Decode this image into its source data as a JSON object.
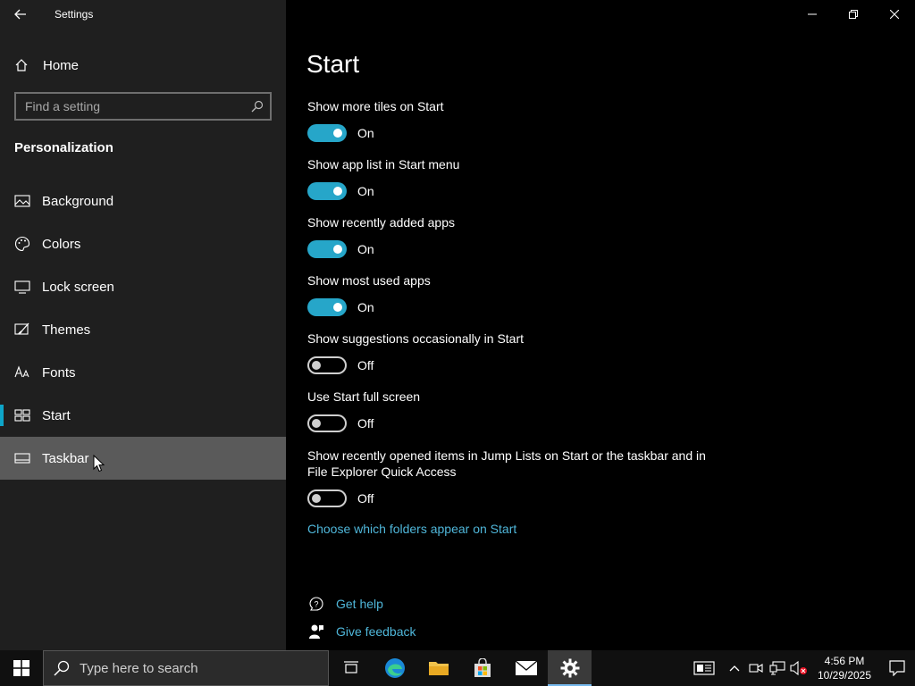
{
  "window": {
    "app_title": "Settings"
  },
  "sidebar": {
    "home_label": "Home",
    "search_placeholder": "Find a setting",
    "section_title": "Personalization",
    "items": [
      {
        "label": "Background",
        "icon": "image-icon"
      },
      {
        "label": "Colors",
        "icon": "palette-icon"
      },
      {
        "label": "Lock screen",
        "icon": "monitor-icon"
      },
      {
        "label": "Themes",
        "icon": "brush-icon"
      },
      {
        "label": "Fonts",
        "icon": "font-icon"
      },
      {
        "label": "Start",
        "icon": "start-tiles-icon",
        "selected": true
      },
      {
        "label": "Taskbar",
        "icon": "taskbar-icon",
        "hovered": true
      }
    ]
  },
  "main": {
    "page_title": "Start",
    "settings": [
      {
        "label": "Show more tiles on Start",
        "state": "On"
      },
      {
        "label": "Show app list in Start menu",
        "state": "On"
      },
      {
        "label": "Show recently added apps",
        "state": "On"
      },
      {
        "label": "Show most used apps",
        "state": "On"
      },
      {
        "label": "Show suggestions occasionally in Start",
        "state": "Off"
      },
      {
        "label": "Use Start full screen",
        "state": "Off"
      },
      {
        "label": "Show recently opened items in Jump Lists on Start or the taskbar and in File Explorer Quick Access",
        "state": "Off"
      }
    ],
    "folders_link": "Choose which folders appear on Start",
    "get_help": "Get help",
    "give_feedback": "Give feedback"
  },
  "taskbar": {
    "search_text": "Type here to search",
    "time": "4:56 PM",
    "date": "10/29/2025"
  },
  "colors": {
    "accent": "#26a6c9",
    "link": "#4fb6d9",
    "sidebar_bg": "#1f1f1f"
  }
}
